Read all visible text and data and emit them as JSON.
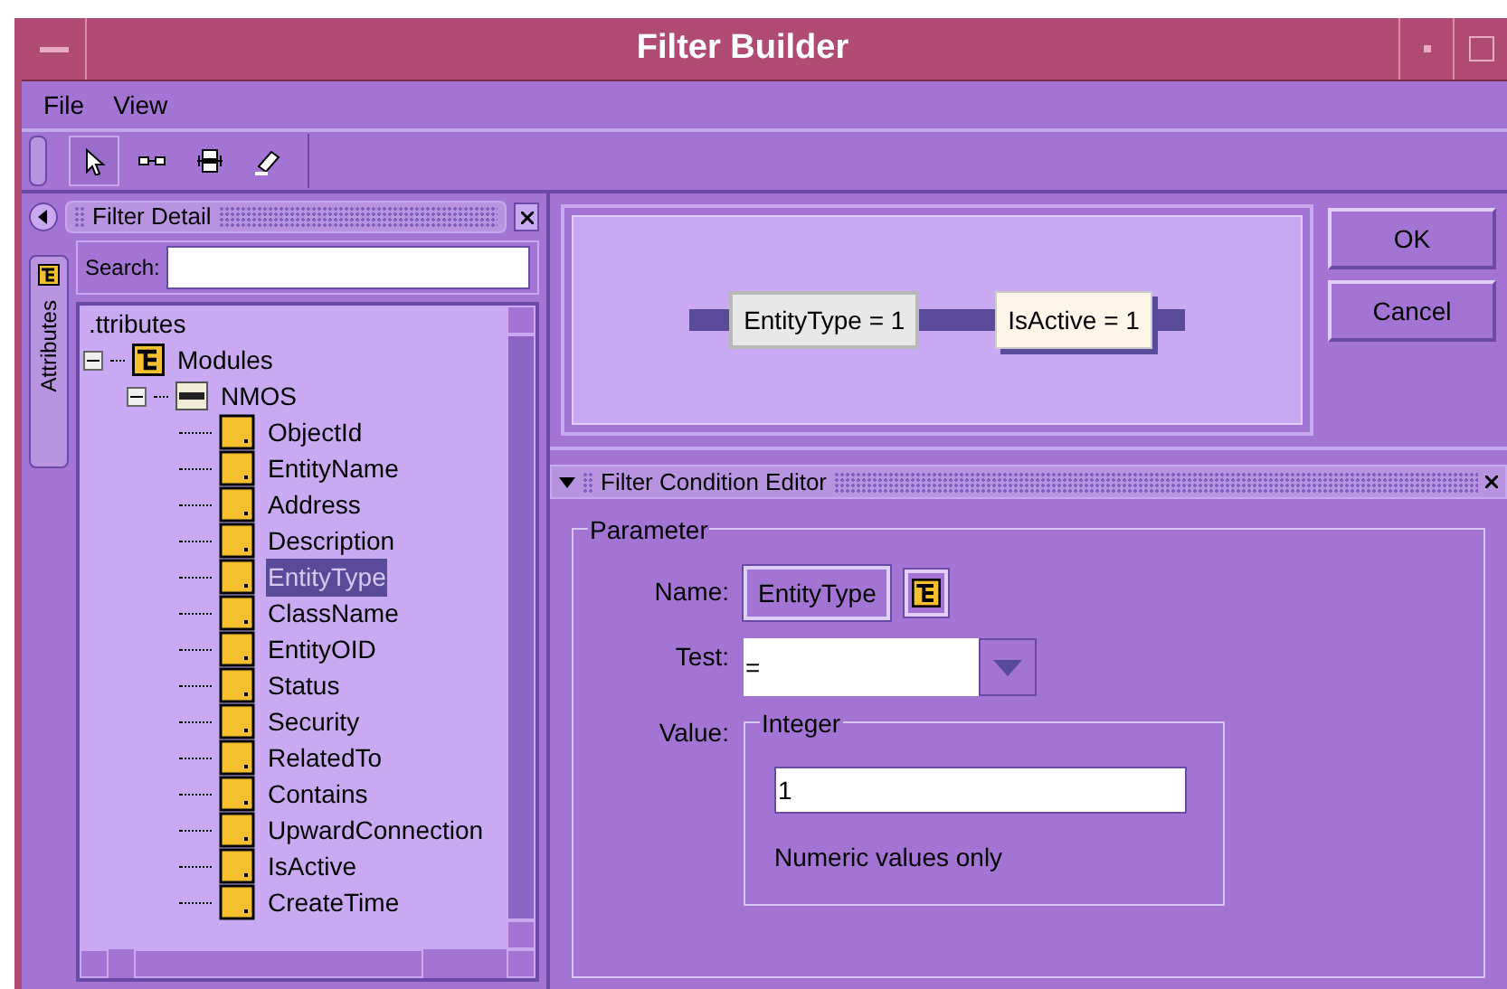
{
  "window": {
    "title": "Filter Builder"
  },
  "menu": [
    {
      "label": "File"
    },
    {
      "label": "View"
    }
  ],
  "toolbar": [
    {
      "kind": "pointer",
      "selected": true
    },
    {
      "kind": "link",
      "selected": false
    },
    {
      "kind": "group",
      "selected": false
    },
    {
      "kind": "eraser",
      "selected": false
    }
  ],
  "filter_detail": {
    "title": "Filter Detail",
    "side_tab": "Attributes",
    "search_label": "Search:"
  },
  "tree": {
    "label": ".ttributes",
    "children": [
      {
        "label": "Modules",
        "kind": "module",
        "expanded": true,
        "children": [
          {
            "label": "NMOS",
            "kind": "mib",
            "expanded": true,
            "children": [
              {
                "label": "ObjectId",
                "kind": "attribute",
                "selected": false
              },
              {
                "label": "EntityName",
                "kind": "attribute",
                "selected": false
              },
              {
                "label": "Address",
                "kind": "attribute",
                "selected": false
              },
              {
                "label": "Description",
                "kind": "attribute",
                "selected": false
              },
              {
                "label": "EntityType",
                "kind": "attribute",
                "selected": true
              },
              {
                "label": "ClassName",
                "kind": "attribute",
                "selected": false
              },
              {
                "label": "EntityOID",
                "kind": "attribute",
                "selected": false
              },
              {
                "label": "Status",
                "kind": "attribute",
                "selected": false
              },
              {
                "label": "Security",
                "kind": "attribute",
                "selected": false
              },
              {
                "label": "RelatedTo",
                "kind": "attribute",
                "selected": false
              },
              {
                "label": "Contains",
                "kind": "attribute",
                "selected": false
              },
              {
                "label": "UpwardConnection",
                "kind": "attribute",
                "selected": false
              },
              {
                "label": "IsActive",
                "kind": "attribute",
                "selected": false
              },
              {
                "label": "CreateTime",
                "kind": "attribute",
                "selected": false
              }
            ]
          }
        ]
      }
    ]
  },
  "diagram": {
    "nodes": [
      {
        "label": "EntityType = 1",
        "selected": true
      },
      {
        "label": "IsActive = 1",
        "selected": false
      }
    ]
  },
  "buttons": [
    {
      "label": "OK"
    },
    {
      "label": "Cancel"
    }
  ],
  "condition_editor": {
    "title": "Filter Condition Editor",
    "group": "Parameter",
    "name_label": "Name:",
    "name_value": "EntityType",
    "test_label": "Test:",
    "test_value": "=",
    "value_label": "Value:",
    "value_group": "Integer",
    "value": "1",
    "hint": "Numeric values only"
  }
}
